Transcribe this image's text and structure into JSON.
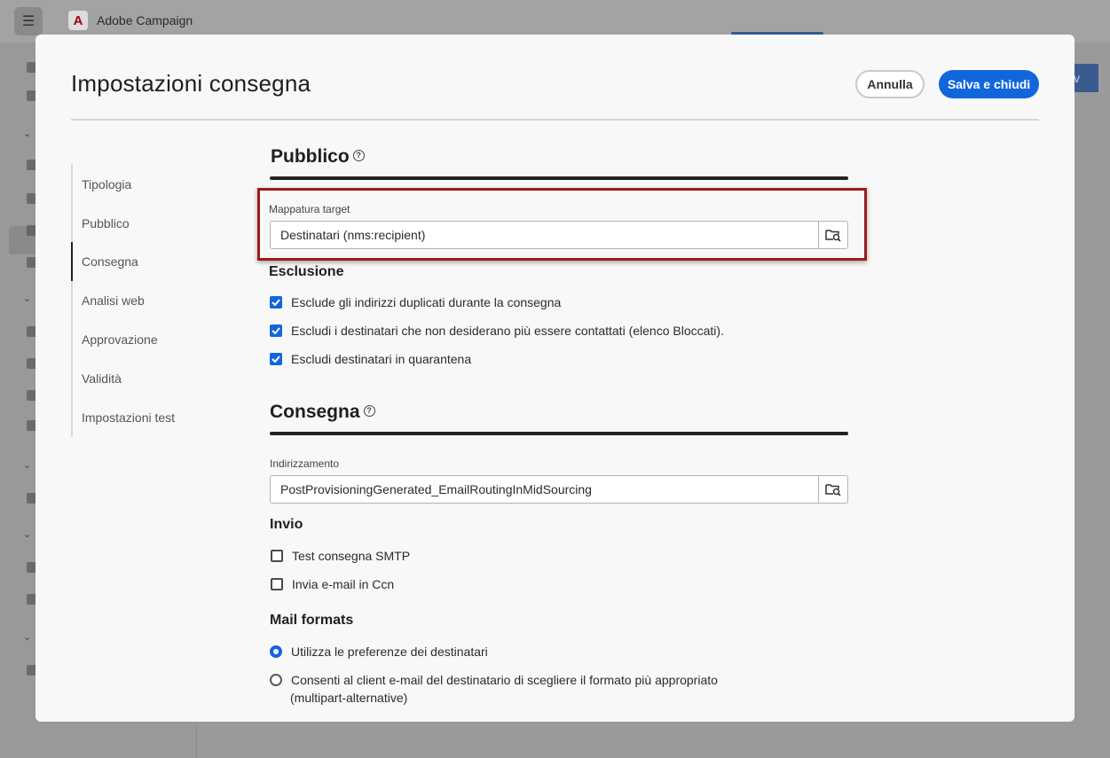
{
  "background_app": {
    "name": "Adobe Campaign",
    "logo_letter": "A"
  },
  "modal": {
    "title": "Impostazioni consegna",
    "cancel_label": "Annulla",
    "save_label": "Salva e chiudi"
  },
  "nav": {
    "items": [
      {
        "label": "Tipologia"
      },
      {
        "label": "Pubblico"
      },
      {
        "label": "Consegna",
        "active": true
      },
      {
        "label": "Analisi web"
      },
      {
        "label": "Approvazione"
      },
      {
        "label": "Validità"
      },
      {
        "label": "Impostazioni test"
      }
    ]
  },
  "pubblico": {
    "title": "Pubblico",
    "target_mapping": {
      "label": "Mappatura target",
      "value": "Destinatari (nms:recipient)"
    },
    "exclusion": {
      "heading": "Esclusione",
      "options": [
        {
          "label": "Esclude gli indirizzi duplicati durante la consegna",
          "checked": true
        },
        {
          "label": "Escludi i destinatari che non desiderano più essere contattati (elenco Bloccati).",
          "checked": true
        },
        {
          "label": "Escludi destinatari in quarantena",
          "checked": true
        }
      ]
    }
  },
  "consegna": {
    "title": "Consegna",
    "routing": {
      "label": "Indirizzamento",
      "value": "PostProvisioningGenerated_EmailRoutingInMidSourcing"
    },
    "send": {
      "heading": "Invio",
      "options": [
        {
          "label": "Test consegna SMTP",
          "checked": false
        },
        {
          "label": "Invia e-mail in Ccn",
          "checked": false
        }
      ]
    },
    "mail_formats": {
      "heading": "Mail formats",
      "options": [
        {
          "label": "Utilizza le preferenze dei destinatari",
          "selected": true
        },
        {
          "label": "Consenti al client e-mail del destinatario di scegliere il formato più appropriato",
          "label_line2": "(multipart-alternative)",
          "selected": false
        }
      ]
    }
  },
  "colors": {
    "accent": "#1266dc",
    "highlight": "#9c1c1c"
  }
}
